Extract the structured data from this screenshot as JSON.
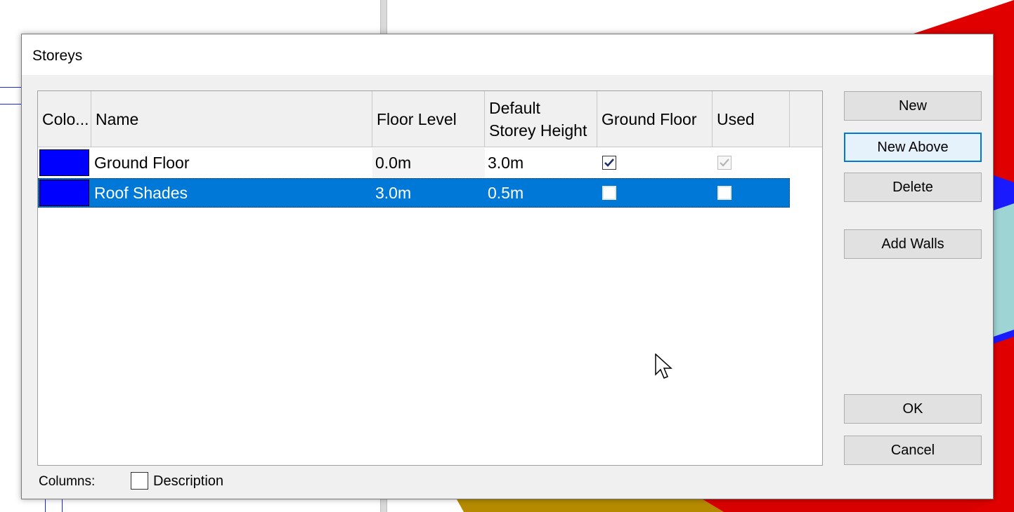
{
  "dialog": {
    "title": "Storeys"
  },
  "grid": {
    "columns": [
      "Colo...",
      "Name",
      "Floor Level",
      "Default\nStorey Height",
      "Ground Floor",
      "Used"
    ],
    "rows": [
      {
        "color": "#0000ff",
        "name": "Ground Floor",
        "floor_level": "0.0m",
        "default_storey_height": "3.0m",
        "ground_floor": true,
        "used": true,
        "used_disabled": true,
        "selected": false
      },
      {
        "color": "#0000ff",
        "name": "Roof Shades",
        "floor_level": "3.0m",
        "default_storey_height": "0.5m",
        "ground_floor": false,
        "used": false,
        "used_disabled": false,
        "selected": true
      }
    ]
  },
  "buttons": {
    "new": "New",
    "new_above": "New Above",
    "delete": "Delete",
    "add_walls": "Add Walls",
    "ok": "OK",
    "cancel": "Cancel"
  },
  "footer": {
    "columns_label": "Columns:",
    "description_label": "Description",
    "description_checked": false
  },
  "colors": {
    "selection": "#0078d7",
    "swatch": "#0000ff",
    "focus_border": "#0078d7"
  }
}
